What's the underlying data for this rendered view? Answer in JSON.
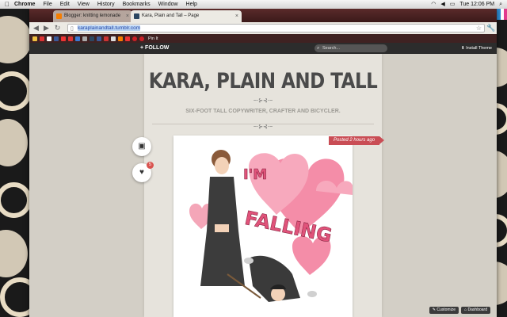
{
  "menubar": {
    "app": "Chrome",
    "items": [
      "File",
      "Edit",
      "View",
      "History",
      "Bookmarks",
      "Window",
      "Help"
    ],
    "clock": "Tue 12:06 PM"
  },
  "browser": {
    "tabs": [
      {
        "label": "Blogger: knitting lemonade",
        "active": false
      },
      {
        "label": "Kara, Plain and Tall – Page",
        "active": true
      }
    ],
    "url": "karaplainandtall.tumblr.com",
    "bookmark_label": "Pin It"
  },
  "tumblr_bar": {
    "follow_label": "FOLLOW",
    "search_placeholder": "Search...",
    "install_label": "Install Theme"
  },
  "blog": {
    "title": "KARA, PLAIN AND TALL",
    "description": "SIX-FOOT TALL COPYWRITER, CRAFTER AND BICYCLER.",
    "posted": "Posted 2 hours ago",
    "notes_count": "5",
    "illustration_text_1": "I'M",
    "illustration_text_2": "FALLING"
  },
  "footer_controls": {
    "customize_label": "Customize",
    "dashboard_label": "Dashboard"
  },
  "colors": {
    "post_tag": "#c94d55",
    "heart_pink": "#f08aa5",
    "title_gray": "#4a4a4a"
  }
}
